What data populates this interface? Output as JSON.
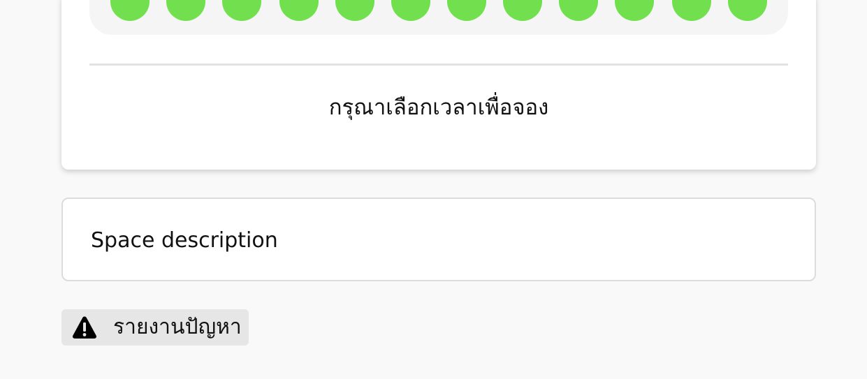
{
  "booking": {
    "prompt": "กรุณาเลือกเวลาเพื่อจอง",
    "slot_color": "#72e04e",
    "slot_count": 12
  },
  "description": {
    "text": "Space description"
  },
  "report": {
    "label": "รายงานปัญหา",
    "icon": "warning-triangle-icon"
  }
}
